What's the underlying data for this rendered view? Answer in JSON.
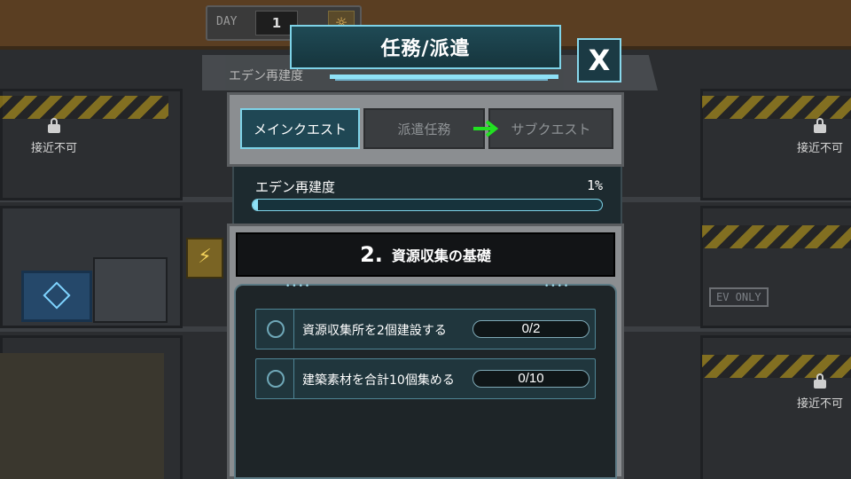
{
  "hud": {
    "day_label": "DAY",
    "day_value": "1",
    "bg_banner_text": "エデン再建度"
  },
  "background": {
    "locked_labels": [
      "接近不可",
      "接近不可",
      "接近不可"
    ],
    "ev_sign": "EV ONLY"
  },
  "modal": {
    "title": "任務/派遣",
    "close_label": "X",
    "tabs": [
      {
        "label": "メインクエスト",
        "active": true
      },
      {
        "label": "派遣任務",
        "active": false
      },
      {
        "label": "サブクエスト",
        "active": false
      }
    ],
    "progress": {
      "label": "エデン再建度",
      "value_text": "1%",
      "fraction": 0.01
    },
    "quest": {
      "number": "2.",
      "title": "資源収集の基礎",
      "tasks": [
        {
          "text": "資源収集所を2個建設する",
          "count": "0/2"
        },
        {
          "text": "建築素材を合計10個集める",
          "count": "0/10"
        }
      ]
    }
  },
  "colors": {
    "accent": "#7ed3e8",
    "arrow": "#22e022"
  }
}
